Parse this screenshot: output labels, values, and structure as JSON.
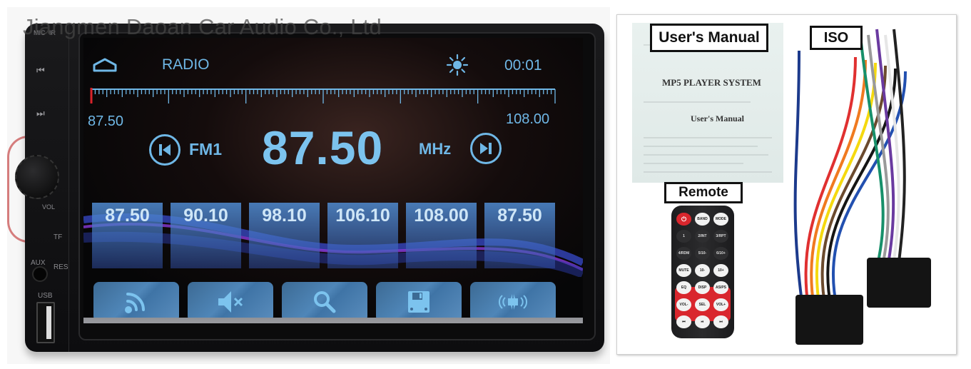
{
  "watermark": "Jiangmen Daoan Car Audio Co., Ltd",
  "head_unit": {
    "side_labels": {
      "mic": "MIC",
      "ir": "IR",
      "vol": "VOL",
      "tf": "TF",
      "aux": "AUX",
      "res": "RES",
      "usb": "USB"
    },
    "side_buttons": {
      "prev": "⏮",
      "next": "⏭"
    },
    "screen": {
      "title": "RADIO",
      "clock": "00:01",
      "dial": {
        "min_label": "87.50",
        "max_label": "108.00",
        "min_mhz": 87.5,
        "max_mhz": 108.0,
        "current_mhz": 87.5
      },
      "band": "FM1",
      "frequency": "87.50",
      "unit": "MHz",
      "presets": [
        "87.50",
        "90.10",
        "98.10",
        "106.10",
        "108.00",
        "87.50"
      ],
      "function_buttons": [
        {
          "name": "signal",
          "icon": "rds-signal-icon"
        },
        {
          "name": "mute",
          "icon": "mute-icon"
        },
        {
          "name": "search",
          "icon": "search-icon"
        },
        {
          "name": "save",
          "icon": "save-icon"
        },
        {
          "name": "stereo",
          "icon": "stereo-speaker-icon"
        }
      ],
      "colors": {
        "accent": "#6fb7e6",
        "preset_text": "#cfe6f7"
      }
    }
  },
  "accessories": {
    "manual_label": "User's Manual",
    "manual_title": "MP5 PLAYER SYSTEM",
    "manual_subtitle": "User's Manual",
    "remote_label": "Remote",
    "iso_label": "ISO",
    "remote_buttons": [
      [
        "⏻",
        "BAND",
        "MODE"
      ],
      [
        "1",
        "2/INT",
        "3/RPT"
      ],
      [
        "4/RDM",
        "5/10-",
        "6/10+"
      ],
      [
        "MUTE",
        "10-",
        "10+"
      ],
      [
        "EQ",
        "DISP",
        "AS/PS"
      ],
      [
        "VOL-",
        "SEL",
        "VOL+"
      ],
      [
        "⏮",
        "⏯",
        "⏭"
      ]
    ],
    "wire_colors": [
      "#1c3a8c",
      "#e03030",
      "#f07a20",
      "#f5d90f",
      "#6b4a2e",
      "#151515",
      "#2250b0",
      "#17906a",
      "#9a9a9a",
      "#6a3aa0",
      "#e6e6e6",
      "#222222"
    ]
  }
}
